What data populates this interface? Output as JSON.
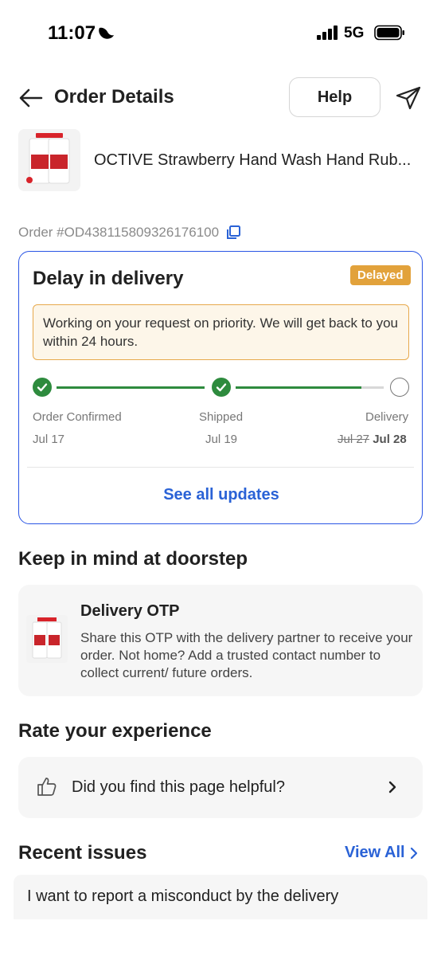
{
  "status_bar": {
    "time": "11:07",
    "network": "5G",
    "icons": [
      "moon-icon",
      "signal-icon",
      "battery-icon"
    ]
  },
  "header": {
    "title": "Order Details",
    "help_label": "Help",
    "icons": [
      "back-arrow-icon",
      "share-icon"
    ]
  },
  "product": {
    "name": "OCTIVE Strawberry Hand Wash Hand Rub...",
    "order_id": "Order #OD438115809326176100",
    "icons": [
      "copy-icon"
    ]
  },
  "delivery_status": {
    "title": "Delay in delivery",
    "badge": "Delayed",
    "notice": "Working on your request on priority. We will get back to you within 24 hours.",
    "progress": 0.85,
    "steps": [
      {
        "label": "Order Confirmed",
        "date": "Jul 17",
        "done": true
      },
      {
        "label": "Shipped",
        "date": "Jul 19",
        "done": true
      },
      {
        "label": "Delivery",
        "old_date": "Jul 27",
        "date": "Jul 28",
        "done": false
      }
    ],
    "see_all_label": "See all updates"
  },
  "doorstep": {
    "title": "Keep in mind at doorstep",
    "otp_title": "Delivery OTP",
    "otp_desc": "Share this OTP with the delivery partner to receive your order. Not home? Add a trusted contact number to collect current/ future orders."
  },
  "rate": {
    "title": "Rate your experience",
    "question": "Did you find this page helpful?"
  },
  "recent_issues": {
    "title": "Recent issues",
    "view_all_label": "View All",
    "items": [
      "I want to report a misconduct by the delivery"
    ]
  },
  "colors": {
    "accent_blue": "#2a62d6",
    "card_border": "#2a55e5",
    "success_green": "#2e8b3e",
    "delayed_badge": "#e2a23b",
    "notice_border": "#e7a94c",
    "notice_bg": "#fdf6e9"
  }
}
